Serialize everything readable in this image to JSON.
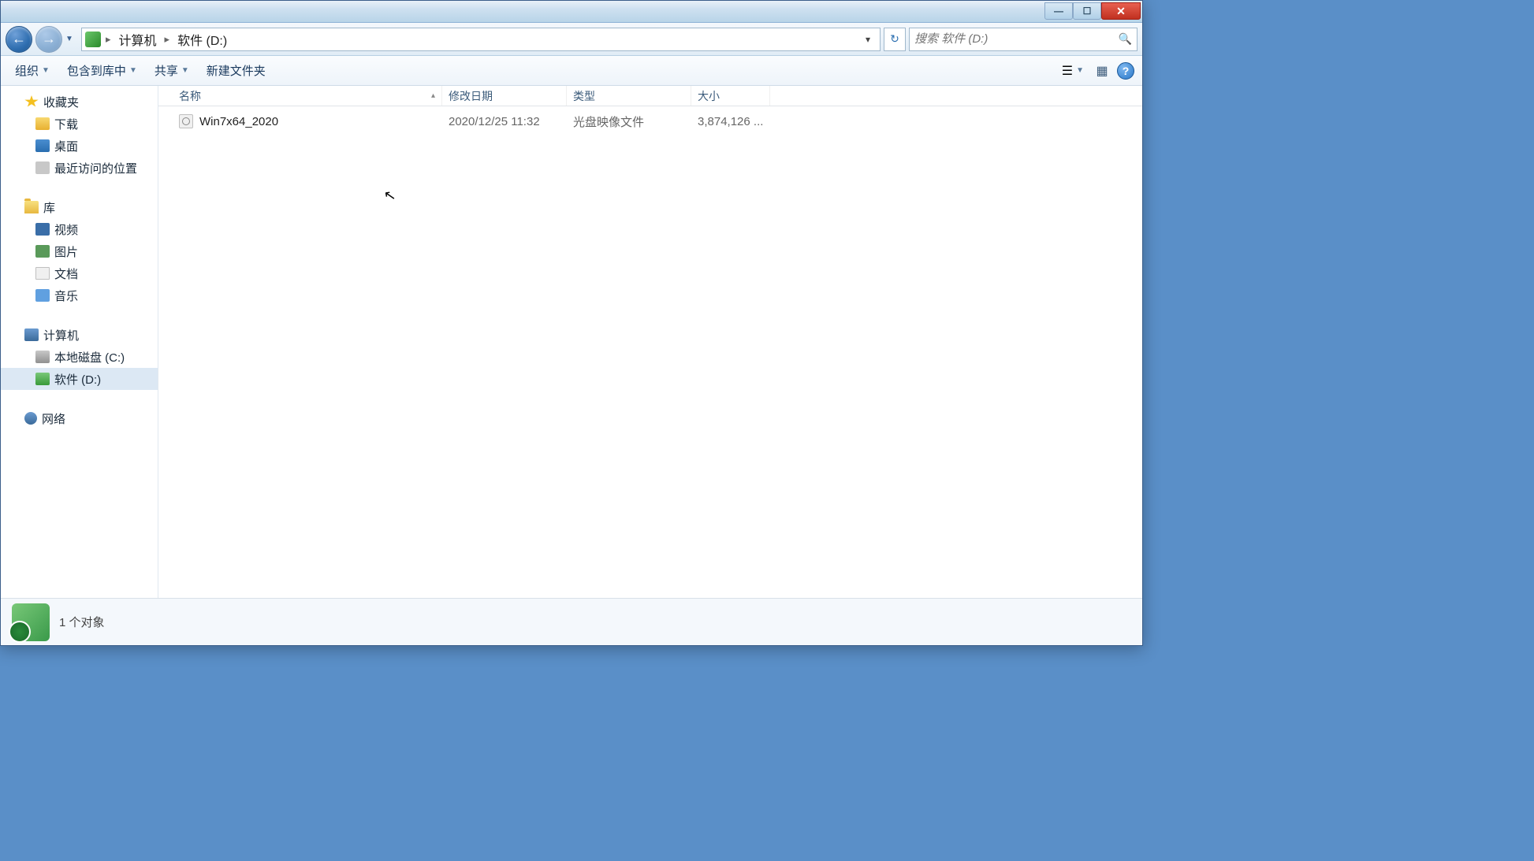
{
  "window": {
    "controls": {
      "min": "—",
      "max": "☐",
      "close": "✕"
    }
  },
  "address": {
    "part1": "计算机",
    "part2": "软件 (D:)"
  },
  "search": {
    "placeholder": "搜索 软件 (D:)"
  },
  "toolbar": {
    "organize": "组织",
    "include": "包含到库中",
    "share": "共享",
    "newfolder": "新建文件夹"
  },
  "sidebar": {
    "favorites": {
      "label": "收藏夹",
      "items": [
        "下载",
        "桌面",
        "最近访问的位置"
      ]
    },
    "libraries": {
      "label": "库",
      "items": [
        "视频",
        "图片",
        "文档",
        "音乐"
      ]
    },
    "computer": {
      "label": "计算机",
      "items": [
        "本地磁盘 (C:)",
        "软件 (D:)"
      ]
    },
    "network": {
      "label": "网络"
    }
  },
  "columns": {
    "name": "名称",
    "date": "修改日期",
    "type": "类型",
    "size": "大小"
  },
  "files": [
    {
      "name": "Win7x64_2020",
      "date": "2020/12/25 11:32",
      "type": "光盘映像文件",
      "size": "3,874,126 ..."
    }
  ],
  "status": {
    "text": "1 个对象"
  }
}
